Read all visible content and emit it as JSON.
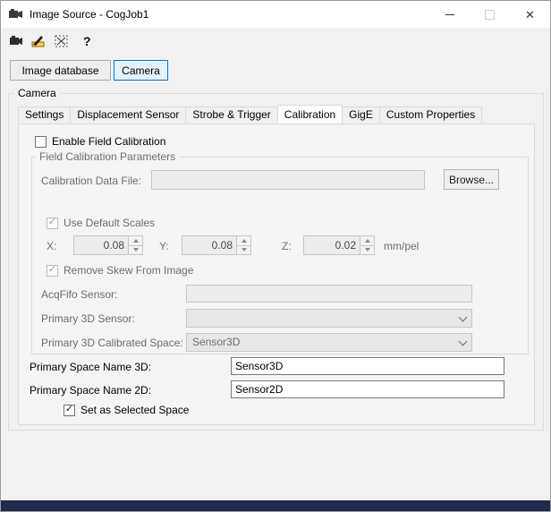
{
  "window": {
    "title": "Image Source - CogJob1",
    "controls": {
      "close": "✕"
    }
  },
  "icons": {
    "check": "✓"
  },
  "toolbar": {
    "icons": [
      "camera-connect-icon",
      "setup-ruler-icon",
      "region-clear-icon",
      "help-icon"
    ]
  },
  "source_buttons": {
    "image_database": "Image database",
    "camera": "Camera"
  },
  "camera_group": {
    "label": "Camera"
  },
  "tabs": {
    "active": "Calibration",
    "items": [
      {
        "label": "Settings"
      },
      {
        "label": "Displacement Sensor"
      },
      {
        "label": "Strobe & Trigger"
      },
      {
        "label": "Calibration"
      },
      {
        "label": "GigE"
      },
      {
        "label": "Custom Properties"
      }
    ]
  },
  "calibration": {
    "enable_field_calibration": {
      "label": "Enable Field Calibration",
      "checked": false
    },
    "field_params": {
      "label": "Field Calibration Parameters",
      "calibration_data_file": {
        "label": "Calibration Data File:",
        "value": "",
        "browse_label": "Browse..."
      },
      "use_default_scales": {
        "label": "Use Default Scales",
        "checked": true
      },
      "scales": {
        "x_label": "X:",
        "x_value": "0.08",
        "y_label": "Y:",
        "y_value": "0.08",
        "z_label": "Z:",
        "z_value": "0.02",
        "unit": "mm/pel"
      },
      "remove_skew": {
        "label": "Remove Skew From Image",
        "checked": true
      },
      "acqfifo_sensor": {
        "label": "AcqFifo Sensor:",
        "value": ""
      },
      "primary_3d_sensor": {
        "label": "Primary 3D Sensor:",
        "value": ""
      },
      "primary_3d_calibrated_space": {
        "label": "Primary 3D Calibrated Space:",
        "value": "Sensor3D"
      }
    },
    "primary_space_name_3d": {
      "label": "Primary Space Name 3D:",
      "value": "Sensor3D"
    },
    "primary_space_name_2d": {
      "label": "Primary Space Name 2D:",
      "value": "Sensor2D"
    },
    "set_as_selected_space": {
      "label": "Set as Selected Space",
      "checked": true
    }
  },
  "colors": {
    "accent": "#0078d7",
    "selected_fill": "#e5f1fb",
    "disabled_text": "#6d6d6d",
    "taskbar": "#1f2a4c"
  }
}
